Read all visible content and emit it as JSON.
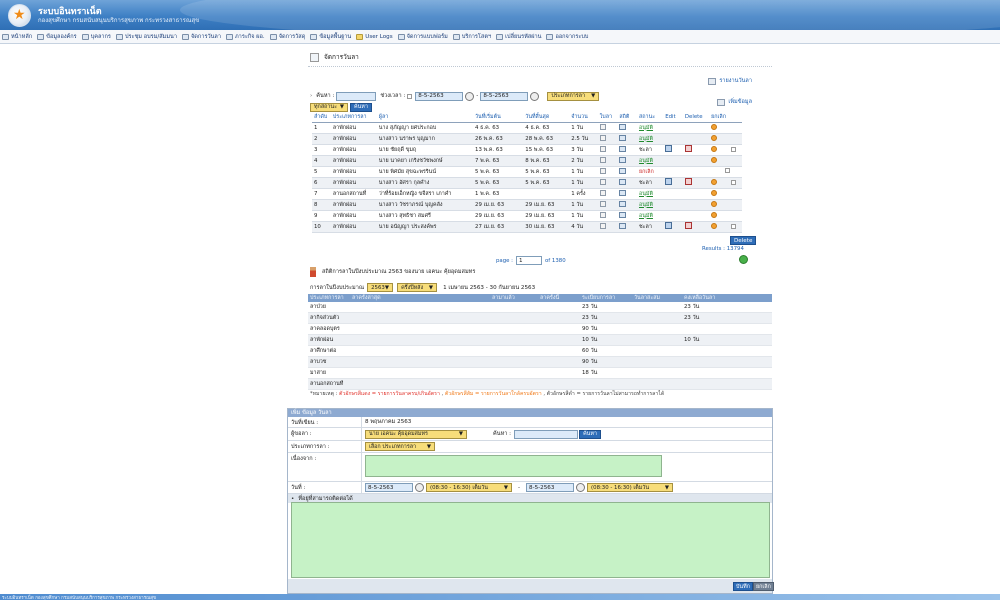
{
  "header": {
    "title": "ระบบอินทราเน็ต",
    "subtitle": "กองสุขศึกษา กรมสนับสนุนบริการสุขภาพ กระทรวงสาธารณสุข"
  },
  "menu": [
    {
      "label": "หน้าหลัก",
      "icon": "home-icon"
    },
    {
      "label": "ข้อมูลองค์กร",
      "icon": "document-icon"
    },
    {
      "label": "บุคลากร",
      "icon": "people-icon"
    },
    {
      "label": "ประชุม อบรม/สัมมนา",
      "icon": "meeting-icon"
    },
    {
      "label": "จัดการวันลา",
      "icon": "calendar-icon"
    },
    {
      "label": "ภาระกิจ ผอ.",
      "icon": "task-icon"
    },
    {
      "label": "จัดการวัสดุ",
      "icon": "box-icon"
    },
    {
      "label": "ข้อมูลพื้นฐาน",
      "icon": "database-icon"
    },
    {
      "label": "User Logs",
      "icon": "log-icon"
    },
    {
      "label": "จัดการแบบฟอร์ม",
      "icon": "form-icon"
    },
    {
      "label": "บริการโสตฯ",
      "icon": "service-icon"
    },
    {
      "label": "เปลี่ยนรหัสผ่าน",
      "icon": "key-icon"
    },
    {
      "label": "ออกจากระบบ",
      "icon": "logout-icon"
    }
  ],
  "page": {
    "title": "จัดการวันลา",
    "report_link": "รายงานวันลา",
    "add_link": "เพิ่มข้อมูล"
  },
  "filter": {
    "search_label": "ค้นหา :",
    "search_value": "",
    "period_label": "ช่วงเวลา :",
    "date_from": "8-5-2563",
    "date_sep": "-",
    "date_to": "8-5-2563",
    "leave_type": "ประเภทการลา",
    "status": "ทุกสถานะ",
    "search_button": "ค้นหา"
  },
  "table": {
    "headers": [
      "ลำดับ",
      "ประเภทการลา",
      "ผู้ลา",
      "วันที่เริ่มต้น",
      "วันที่สิ้นสุด",
      "จำนวน",
      "ใบลา",
      "สถิติ",
      "สถานะ",
      "Edit",
      "Delete",
      "ยกเลิก"
    ],
    "rows": [
      {
        "no": "1",
        "type": "ลาพักผ่อน",
        "name": "นาง สุภัญญา ยศประกอบ",
        "start": "4 ธ.ค. 63",
        "end": "4 ธ.ค. 63",
        "days": "1 วัน",
        "status": "อนุมัติ",
        "st": "ok",
        "edit": false,
        "del": false,
        "cancel": true,
        "check": false
      },
      {
        "no": "2",
        "type": "ลาพักผ่อน",
        "name": "นางสาว นราพร บุญมาก",
        "start": "26 พ.ค. 63",
        "end": "28 พ.ค. 63",
        "days": "2.5 วัน",
        "status": "อนุมัติ",
        "st": "ok",
        "edit": false,
        "del": false,
        "cancel": true,
        "check": false
      },
      {
        "no": "3",
        "type": "ลาพักผ่อน",
        "name": "นาย ชัยฤดี ขุมฤ",
        "start": "13 พ.ค. 63",
        "end": "15 พ.ค. 63",
        "days": "3 วัน",
        "status": "ชะลา",
        "st": "plain",
        "edit": true,
        "del": true,
        "cancel": true,
        "check": true
      },
      {
        "no": "4",
        "type": "ลาพักผ่อน",
        "name": "นาย นาคยา เกริงชวัชพงกษ์",
        "start": "7 พ.ค. 63",
        "end": "8 พ.ค. 63",
        "days": "2 วัน",
        "status": "อนุมัติ",
        "st": "ok",
        "edit": false,
        "del": false,
        "cancel": true,
        "check": false
      },
      {
        "no": "5",
        "type": "ลาพักผ่อน",
        "name": "นาย พิศมัย สุขฉะพรรินน์",
        "start": "5 พ.ค. 63",
        "end": "5 พ.ค. 63",
        "days": "1 วัน",
        "status": "ยกเลิก",
        "st": "cancel",
        "edit": false,
        "del": false,
        "cancel": false,
        "check": true
      },
      {
        "no": "6",
        "type": "ลาพักผ่อน",
        "name": "นางสาว อัศรา กุลคำง",
        "start": "5 พ.ค. 63",
        "end": "5 พ.ค. 63",
        "days": "1 วัน",
        "status": "ชะลา",
        "st": "plain",
        "edit": true,
        "del": true,
        "cancel": true,
        "check": true
      },
      {
        "no": "7",
        "type": "ลานอกสถานที่",
        "name": "ว่าที่ร้อยเอ็กหญิง ขจีสรา เภาคำ",
        "start": "1 พ.ค. 63",
        "end": "",
        "days": "1 ครั้ง",
        "status": "อนุมัติ",
        "st": "ok",
        "edit": false,
        "del": false,
        "cancel": true,
        "check": false
      },
      {
        "no": "8",
        "type": "ลาพักผ่อน",
        "name": "นางสาว วัชราภรณ์ บุญคลัง",
        "start": "29 เม.ย. 63",
        "end": "29 เม.ย. 63",
        "days": "1 วัน",
        "status": "อนุมัติ",
        "st": "ok",
        "edit": false,
        "del": false,
        "cancel": true,
        "check": false
      },
      {
        "no": "9",
        "type": "ลาพักผ่อน",
        "name": "นางสาว สุทธิชา สมศรี",
        "start": "29 เม.ย. 63",
        "end": "29 เม.ย. 63",
        "days": "1 วัน",
        "status": "อนุมัติ",
        "st": "ok",
        "edit": false,
        "del": false,
        "cancel": true,
        "check": false
      },
      {
        "no": "10",
        "type": "ลาพักผ่อน",
        "name": "นาย อนัญญา ประสงค์พร",
        "start": "27 เม.ย. 63",
        "end": "30 เม.ย. 63",
        "days": "4 วัน",
        "status": "ชะลา",
        "st": "plain",
        "edit": true,
        "del": true,
        "cancel": true,
        "check": true
      }
    ],
    "delete_button": "Delete",
    "results_label": "Results :",
    "results_count": "13794",
    "page_label": "page :",
    "page_value": "1",
    "page_total": "of 1380"
  },
  "stats": {
    "title": "สถิติการลาในปีงบประมาณ 2563 ของนาย เอคนะ คุ้ยอุดมสมทร",
    "fy_label": "การลาในปีงบประมาณ",
    "fy_value": "2563",
    "half_value": "ครึ่งปีหลัง",
    "range": "1 เมษายน 2563 - 30 กันยายน 2563",
    "headers": [
      "ประเภทการลา",
      "ลาครั้งล่าสุด",
      "ลามาแล้ว",
      "ลาครั้งนี้",
      "ระเบียบการลา",
      "วันลาสะสม",
      "คงเหลือวันลา"
    ],
    "rows": [
      {
        "type": "ลาป่วย",
        "rule": "23 วัน",
        "remain": "23 วัน"
      },
      {
        "type": "ลากิจส่วนตัว",
        "rule": "23 วัน",
        "remain": "23 วัน"
      },
      {
        "type": "ลาคลอดบุตร",
        "rule": "90 วัน",
        "remain": ""
      },
      {
        "type": "ลาพักผ่อน",
        "rule": "10 วัน",
        "remain": "10 วัน"
      },
      {
        "type": "ลาศึกษาต่อ",
        "rule": "60 วัน",
        "remain": ""
      },
      {
        "type": "ลาบวช",
        "rule": "90 วัน",
        "remain": ""
      },
      {
        "type": "มาสาย",
        "rule": "18 วัน",
        "remain": ""
      },
      {
        "type": "ลานอกสถานที่",
        "rule": "",
        "remain": ""
      }
    ],
    "note_prefix": "*หมายเหตุ : ",
    "note_red": "ตัวอักษรสีแดง = รายการวันลาครบ/เกินอัตรา",
    "note_sep": " , ",
    "note_orange": "ตัวอักษรสีส้ม = รายการวันลาใกล้ครบอัตรา",
    "note_black": "ตัวอักษรสีดำ = รายการวันลาไม่สามารถทำการลาได้"
  },
  "form": {
    "title": "เพิ่ม ข้อมูล วันลา",
    "date_label": "วันที่เขียน :",
    "date_value": "8 พฤษภาคม 2563",
    "leaver_label": "ผู้ขอลา :",
    "leaver_value": "นาย เอคนะ คุ้ยอุดมสมทร",
    "search_label": "ค้นหา :",
    "search_button": "ค้นหา",
    "type_label": "ประเภทการลา :",
    "type_value": "เลือก ประเภทการลา",
    "reason_label": "เนื่องจาก :",
    "day_label": "วันที่ :",
    "from_date": "8-5-2563",
    "from_time": "(08:30 - 16:30) เต็มวัน",
    "to_sep": "-",
    "to_date": "8-5-2563",
    "to_time": "(08:30 - 16:30) เต็มวัน",
    "contact_label": "ที่อยู่ที่สามารถติดต่อได้",
    "save_button": "บันทึก",
    "cancel_button": "ยกเลิก"
  },
  "footer": {
    "text": "ระบบอินทราเน็ต กองสุขศึกษา กรมสนับสนุนบริการสุขภาพ กระทรวงสาธารณสุข"
  },
  "colors": {
    "header": "#3d7fc4",
    "link": "#1d5fb0",
    "approved": "#1f8a2d",
    "cancelled": "#cc2a2a",
    "input_bg": "#dceaf9",
    "select_bg": "#f7dd7a",
    "textarea_bg": "#c6f2c6"
  }
}
